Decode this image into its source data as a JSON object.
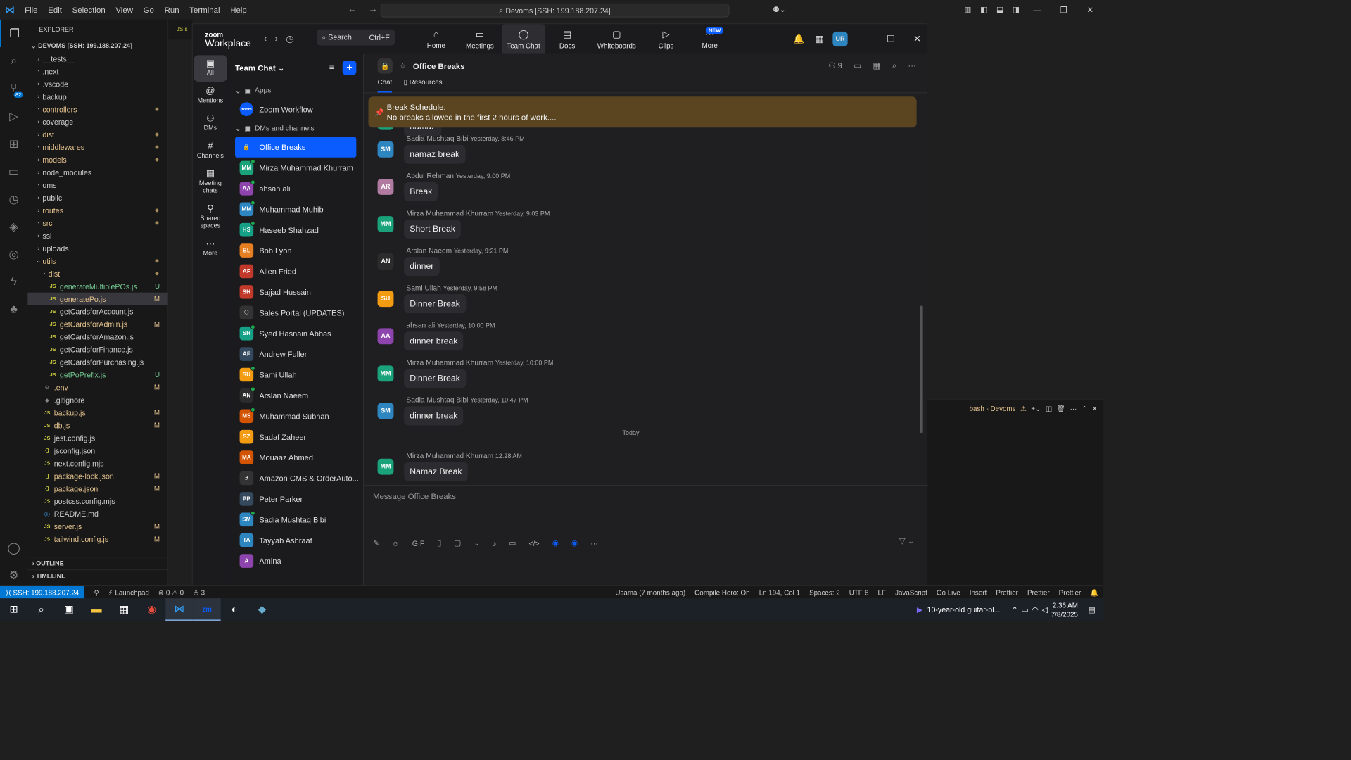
{
  "vscode": {
    "menu": [
      "File",
      "Edit",
      "Selection",
      "View",
      "Go",
      "Run",
      "Terminal",
      "Help"
    ],
    "search": "Devoms [SSH: 199.188.207.24]",
    "explorer": {
      "title": "EXPLORER",
      "root": "DEVOMS [SSH: 199.188.207.24]",
      "items": [
        {
          "label": "__tests__",
          "type": "folder",
          "indent": 0
        },
        {
          "label": ".next",
          "type": "folder",
          "indent": 0
        },
        {
          "label": ".vscode",
          "type": "folder",
          "indent": 0
        },
        {
          "label": "backup",
          "type": "folder",
          "indent": 0
        },
        {
          "label": "controllers",
          "type": "folder",
          "indent": 0,
          "dot": true
        },
        {
          "label": "coverage",
          "type": "folder",
          "indent": 0
        },
        {
          "label": "dist",
          "type": "folder",
          "indent": 0,
          "dot": true
        },
        {
          "label": "middlewares",
          "type": "folder",
          "indent": 0,
          "dot": true
        },
        {
          "label": "models",
          "type": "folder",
          "indent": 0,
          "dot": true
        },
        {
          "label": "node_modules",
          "type": "folder",
          "indent": 0
        },
        {
          "label": "oms",
          "type": "folder",
          "indent": 0
        },
        {
          "label": "public",
          "type": "folder",
          "indent": 0
        },
        {
          "label": "routes",
          "type": "folder",
          "indent": 0,
          "dot": true
        },
        {
          "label": "src",
          "type": "folder",
          "indent": 0,
          "dot": true
        },
        {
          "label": "ssl",
          "type": "folder",
          "indent": 0
        },
        {
          "label": "uploads",
          "type": "folder",
          "indent": 0
        },
        {
          "label": "utils",
          "type": "folder-open",
          "indent": 0,
          "dot": true
        },
        {
          "label": "dist",
          "type": "folder",
          "indent": 1,
          "dot": true
        },
        {
          "label": "generateMultiplePOs.js",
          "type": "js",
          "indent": 1,
          "status": "U"
        },
        {
          "label": "generatePo.js",
          "type": "js",
          "indent": 1,
          "status": "M",
          "selected": true
        },
        {
          "label": "getCardsforAccount.js",
          "type": "js",
          "indent": 1
        },
        {
          "label": "getCardsforAdmin.js",
          "type": "js",
          "indent": 1,
          "status": "M"
        },
        {
          "label": "getCardsforAmazon.js",
          "type": "js",
          "indent": 1
        },
        {
          "label": "getCardsforFinance.js",
          "type": "js",
          "indent": 1
        },
        {
          "label": "getCardsforPurchasing.js",
          "type": "js",
          "indent": 1
        },
        {
          "label": "getPoPrefix.js",
          "type": "js",
          "indent": 1,
          "status": "U"
        },
        {
          "label": ".env",
          "type": "gear",
          "indent": 0,
          "status": "M"
        },
        {
          "label": ".gitignore",
          "type": "git",
          "indent": 0
        },
        {
          "label": "backup.js",
          "type": "js",
          "indent": 0,
          "status": "M"
        },
        {
          "label": "db.js",
          "type": "js",
          "indent": 0,
          "status": "M"
        },
        {
          "label": "jest.config.js",
          "type": "js",
          "indent": 0
        },
        {
          "label": "jsconfig.json",
          "type": "json",
          "indent": 0
        },
        {
          "label": "next.config.mjs",
          "type": "js",
          "indent": 0
        },
        {
          "label": "package-lock.json",
          "type": "json",
          "indent": 0,
          "status": "M"
        },
        {
          "label": "package.json",
          "type": "json",
          "indent": 0,
          "status": "M"
        },
        {
          "label": "postcss.config.mjs",
          "type": "js",
          "indent": 0
        },
        {
          "label": "README.md",
          "type": "info",
          "indent": 0
        },
        {
          "label": "server.js",
          "type": "js",
          "indent": 0,
          "status": "M"
        },
        {
          "label": "tailwind.config.js",
          "type": "js",
          "indent": 0,
          "status": "M"
        }
      ],
      "outline": "OUTLINE",
      "timeline": "TIMELINE"
    },
    "editor_tab": "JS s",
    "terminal_title": "bash - Devoms",
    "source_control_badge": "82",
    "status": {
      "ssh": "SSH: 199.188.207.24",
      "launchpad": "Launchpad",
      "errors": "0",
      "warnings": "0",
      "ports": "3",
      "blame": "Usama (7 months ago)",
      "compile": "Compile Hero: On",
      "position": "Ln 194, Col 1",
      "spaces": "Spaces: 2",
      "encoding": "UTF-8",
      "eol": "LF",
      "language": "JavaScript",
      "golive": "Go Live",
      "insert": "Insert",
      "prettier1": "Prettier",
      "prettier2": "Prettier",
      "prettier3": "Prettier"
    }
  },
  "zoom": {
    "logo_top": "zoom",
    "logo_bottom": "Workplace",
    "search": "Search",
    "search_shortcut": "Ctrl+F",
    "tabs": [
      {
        "label": "Home",
        "icon": "⌂"
      },
      {
        "label": "Meetings",
        "icon": "▭"
      },
      {
        "label": "Team Chat",
        "icon": "◯"
      },
      {
        "label": "Docs",
        "icon": "▤"
      },
      {
        "label": "Whiteboards",
        "icon": "▢"
      },
      {
        "label": "Clips",
        "icon": "▷"
      },
      {
        "label": "More",
        "icon": "···",
        "badge": "NEW"
      }
    ],
    "user_initials": "UR",
    "rail": [
      {
        "label": "All",
        "icon": "▣"
      },
      {
        "label": "Mentions",
        "icon": "@"
      },
      {
        "label": "DMs",
        "icon": "⚇"
      },
      {
        "label": "Channels",
        "icon": "#"
      },
      {
        "label": "Meeting chats",
        "icon": "▦"
      },
      {
        "label": "Shared spaces",
        "icon": "⚲"
      },
      {
        "label": "More",
        "icon": "···"
      }
    ],
    "list_title": "Team Chat",
    "apps_section": "Apps",
    "apps": [
      {
        "label": "Zoom Workflow",
        "initials": "zoom",
        "color": "#0b5cff"
      }
    ],
    "dm_section": "DMs and channels",
    "chats": [
      {
        "label": "Office Breaks",
        "initials": "🔒",
        "color": "#0b5cff",
        "selected": true
      },
      {
        "label": "Mirza Muhammad Khurram",
        "initials": "MM",
        "color": "#1aa37a",
        "presence": true
      },
      {
        "label": "ahsan ali",
        "initials": "AA",
        "color": "#8e44ad",
        "presence": true
      },
      {
        "label": "Muhammad Muhib",
        "initials": "MM",
        "color": "#2e86c1",
        "presence": true
      },
      {
        "label": "Haseeb Shahzad",
        "initials": "HS",
        "color": "#16a085",
        "presence": true
      },
      {
        "label": "Bob Lyon",
        "initials": "BL",
        "color": "#e67e22"
      },
      {
        "label": "Allen Fried",
        "initials": "AF",
        "color": "#c0392b"
      },
      {
        "label": "Sajjad Hussain",
        "initials": "SH",
        "color": "#c0392b"
      },
      {
        "label": "Sales Portal (UPDATES)",
        "initials": "⚇",
        "color": "#333"
      },
      {
        "label": "Syed Hasnain Abbas",
        "initials": "SH",
        "color": "#16a085",
        "presence": true
      },
      {
        "label": "Andrew Fuller",
        "initials": "AF",
        "color": "#34495e"
      },
      {
        "label": "Sami Ullah",
        "initials": "SU",
        "color": "#f39c12",
        "presence": true
      },
      {
        "label": "Arslan Naeem",
        "initials": "AN",
        "color": "#2c2c2c",
        "presence": true
      },
      {
        "label": "Muhammad Subhan",
        "initials": "MS",
        "color": "#d35400",
        "presence": true
      },
      {
        "label": "Sadaf Zaheer",
        "initials": "SZ",
        "color": "#f39c12"
      },
      {
        "label": "Mouaaz Ahmed",
        "initials": "MA",
        "color": "#d35400"
      },
      {
        "label": "Amazon CMS & OrderAuto...",
        "initials": "#",
        "color": "#333"
      },
      {
        "label": "Peter Parker",
        "initials": "PP",
        "color": "#34495e"
      },
      {
        "label": "Sadia Mushtaq Bibi",
        "initials": "SM",
        "color": "#2e86c1",
        "presence": true
      },
      {
        "label": "Tayyab Ashraaf",
        "initials": "TA",
        "color": "#2e86c1"
      },
      {
        "label": "Amina",
        "initials": "A",
        "color": "#8e44ad"
      }
    ],
    "channel": {
      "name": "Office Breaks",
      "members": "9",
      "tab_chat": "Chat",
      "tab_resources": "Resources"
    },
    "pinned": {
      "title": "Break Schedule:",
      "text": "No breaks allowed in the first 2 hours of work...."
    },
    "partial_top": "namaz",
    "messages": [
      {
        "author": "",
        "time": "",
        "text": "namaz",
        "initials": "MM",
        "color": "#1aa37a"
      },
      {
        "author": "Sadia Mushtaq Bibi",
        "time": "Yesterday, 8:46 PM",
        "text": "namaz break",
        "initials": "SM",
        "color": "#2e86c1"
      },
      {
        "author": "Abdul Rehman",
        "time": "Yesterday, 9:00 PM",
        "text": "Break",
        "initials": "AR",
        "color": "#b07aa1"
      },
      {
        "author": "Mirza Muhammad Khurram",
        "time": "Yesterday, 9:03 PM",
        "text": "Short Break",
        "initials": "MM",
        "color": "#1aa37a"
      },
      {
        "author": "Arslan Naeem",
        "time": "Yesterday, 9:21 PM",
        "text": "dinner",
        "initials": "AN",
        "color": "#2c2c2c"
      },
      {
        "author": "Sami Ullah",
        "time": "Yesterday, 9:58 PM",
        "text": "Dinner Break",
        "initials": "SU",
        "color": "#f39c12"
      },
      {
        "author": "ahsan ali",
        "time": "Yesterday, 10:00 PM",
        "text": "dinner break",
        "initials": "AA",
        "color": "#8e44ad"
      },
      {
        "author": "Mirza Muhammad Khurram",
        "time": "Yesterday, 10:00 PM",
        "text": "Dinner Break",
        "initials": "MM",
        "color": "#1aa37a"
      },
      {
        "author": "Sadia Mushtaq Bibi",
        "time": "Yesterday, 10:47 PM",
        "text": "dinner break",
        "initials": "SM",
        "color": "#2e86c1"
      },
      {
        "author": "Mirza Muhammad Khurram",
        "time": "12:28 AM",
        "text": "Namaz Break",
        "initials": "MM",
        "color": "#1aa37a"
      }
    ],
    "divider_today": "Today",
    "composer_placeholder": "Message Office Breaks",
    "composer_tools": [
      "✎",
      "☺",
      "GIF",
      "▯",
      "▢",
      "⌄",
      "♪",
      "▭",
      "</>",
      "◉",
      "◉",
      "···"
    ]
  },
  "taskbar": {
    "media": "10-year-old guitar-pl...",
    "time": "2:36 AM",
    "date": "7/8/2025"
  }
}
